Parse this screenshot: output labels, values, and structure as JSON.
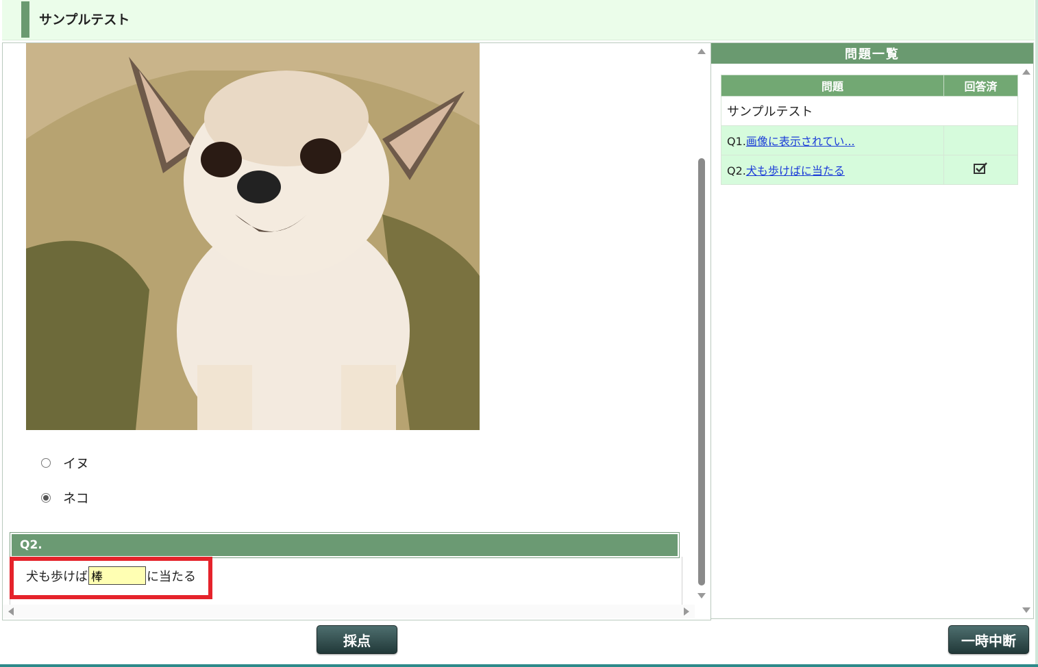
{
  "header": {
    "title": "サンプルテスト"
  },
  "main": {
    "q1_choices": [
      {
        "label": "イヌ",
        "checked": false
      },
      {
        "label": "ネコ",
        "checked": true
      }
    ],
    "q2": {
      "number": "Q2.",
      "text_before": "犬も歩けば",
      "answer_value": "棒",
      "text_after": "に当たる"
    }
  },
  "side": {
    "title": "問題一覧",
    "columns": [
      "問題",
      "回答済"
    ],
    "group_label": "サンプルテスト",
    "items": [
      {
        "number": "Q1.",
        "link": "画像に表示されてい...",
        "answered": false
      },
      {
        "number": "Q2.",
        "link": "犬も歩けばに当たる",
        "answered": true
      }
    ]
  },
  "buttons": {
    "grade": "採点",
    "pause": "一時中断"
  },
  "colors": {
    "header_bar": "#6a9a70",
    "q_header": "#6b9a73",
    "highlight": "#e5232b",
    "input_bg": "#ffffb3"
  }
}
